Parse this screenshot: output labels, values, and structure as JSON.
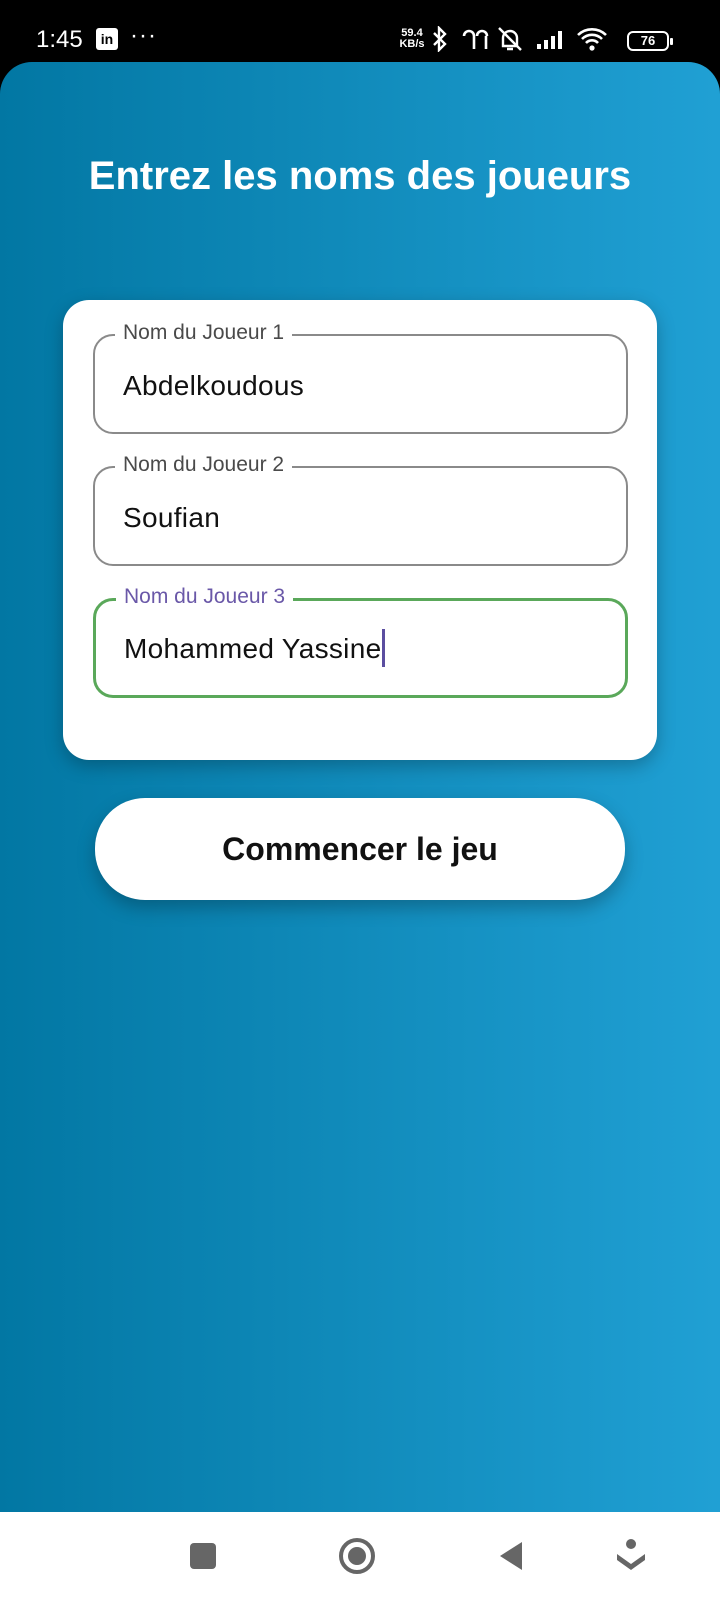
{
  "status_bar": {
    "time": "1:45",
    "app_badge": "in",
    "more": "···",
    "network_speed_value": "59.4",
    "network_speed_unit": "KB/s",
    "battery": "76"
  },
  "page": {
    "title": "Entrez les noms des joueurs"
  },
  "fields": [
    {
      "label": "Nom du Joueur 1",
      "value": "Abdelkoudous"
    },
    {
      "label": "Nom du Joueur 2",
      "value": "Soufian"
    },
    {
      "label": "Nom du Joueur 3",
      "value": "Mohammed Yassine"
    }
  ],
  "start_button_label": "Commencer le jeu",
  "colors": {
    "gradient_start": "#0277a3",
    "gradient_end": "#20a0d4",
    "focused_border": "#5aa85a",
    "focused_label": "#6a58a8"
  },
  "icons": {
    "status": [
      "linkedin-icon",
      "bluetooth-icon",
      "earbuds-icon",
      "vibrate-off-icon",
      "signal-icon",
      "wifi-icon",
      "battery-icon"
    ],
    "nav": [
      "recents-icon",
      "home-icon",
      "back-icon",
      "assistant-icon"
    ]
  }
}
